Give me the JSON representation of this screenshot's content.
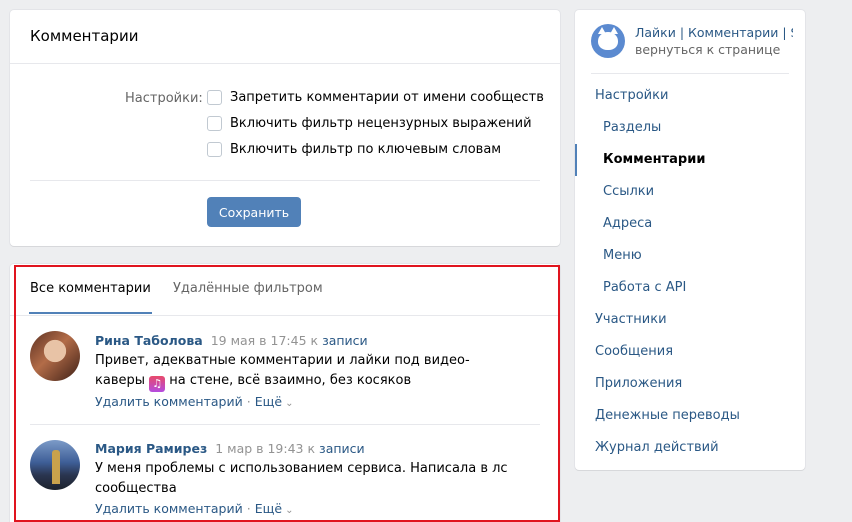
{
  "settings": {
    "title": "Комментарии",
    "label": "Настройки:",
    "options": [
      "Запретить комментарии от имени сообществ",
      "Включить фильтр нецензурных выражений",
      "Включить фильтр по ключевым словам"
    ],
    "save_label": "Сохранить"
  },
  "comments": {
    "tabs": [
      "Все комментарии",
      "Удалённые фильтром"
    ],
    "items": [
      {
        "author": "Рина Таболова",
        "date": "19 мая в 17:45",
        "to": "к",
        "to_link": "записи",
        "text": "Привет, адекватные комментарии и лайки под видео-каверы",
        "text_after": "на стене, всё взаимно, без косяков",
        "delete": "Удалить комментарий",
        "more": "Ещё"
      },
      {
        "author": "Мария Рамирез",
        "date": "1 мар в 19:43",
        "to": "к",
        "to_link": "записи",
        "text": "У меня проблемы с использованием сервиса. Написала в лс сообщества",
        "delete": "Удалить комментарий",
        "more": "Ещё"
      }
    ]
  },
  "menu": {
    "group_name": "Лайки | Комментарии | S...",
    "back": "вернуться к странице",
    "items": [
      "Настройки",
      "Разделы",
      "Комментарии",
      "Ссылки",
      "Адреса",
      "Меню",
      "Работа с API",
      "Участники",
      "Сообщения",
      "Приложения",
      "Денежные переводы",
      "Журнал действий"
    ]
  },
  "colors": {
    "accent": "#5181b8",
    "link": "#2a5885",
    "highlight": "#e0141e"
  }
}
